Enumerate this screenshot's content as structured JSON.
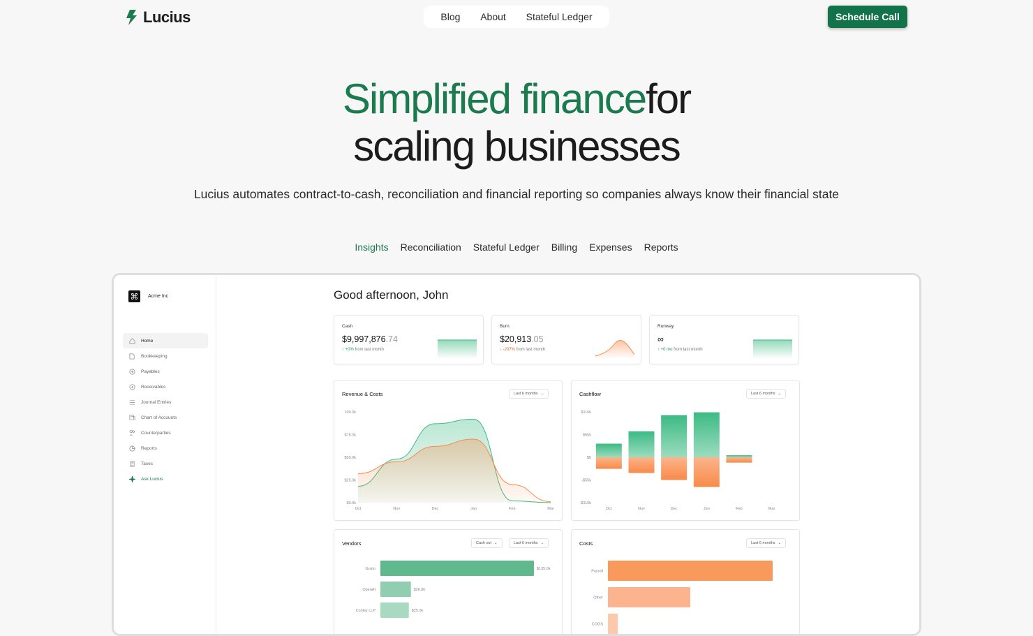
{
  "brand": {
    "name": "Lucius"
  },
  "nav": {
    "items": [
      "Blog",
      "About",
      "Stateful Ledger"
    ],
    "cta": "Schedule Call"
  },
  "hero": {
    "title_green": "Simplified finance",
    "title_dark_1": "for",
    "title_dark_2": "scaling businesses",
    "subtitle": "Lucius automates contract-to-cash, reconciliation and financial reporting so companies always know their financial state"
  },
  "tabs": [
    {
      "label": "Insights",
      "active": true
    },
    {
      "label": "Reconciliation"
    },
    {
      "label": "Stateful Ledger"
    },
    {
      "label": "Billing"
    },
    {
      "label": "Expenses"
    },
    {
      "label": "Reports"
    }
  ],
  "colors": {
    "accent": "#1b7a4e",
    "green": "#3dba84",
    "orange": "#f98a4a"
  },
  "app": {
    "org": "Acme Inc",
    "greeting": "Good afternoon, John",
    "sidebar": [
      {
        "label": "Home",
        "icon": "home-icon",
        "active": true
      },
      {
        "label": "Bookkeeping",
        "icon": "book-icon"
      },
      {
        "label": "Payables",
        "icon": "circle-plus-icon"
      },
      {
        "label": "Receivables",
        "icon": "circle-plus-icon"
      },
      {
        "label": "Journal Entries",
        "icon": "list-icon"
      },
      {
        "label": "Chart of Accounts",
        "icon": "accounts-icon"
      },
      {
        "label": "Counterparties",
        "icon": "users-icon"
      },
      {
        "label": "Reports",
        "icon": "pie-icon"
      },
      {
        "label": "Taxes",
        "icon": "receipt-icon"
      },
      {
        "label": "Ask Lucius",
        "icon": "sparkle-icon",
        "accent": true
      }
    ],
    "kpis": [
      {
        "label": "Cash",
        "value_main": "$9,997,876",
        "value_dec": ".74",
        "change": "+0%",
        "change_suffix": " from last month",
        "dir": "up"
      },
      {
        "label": "Burn",
        "value_main": "$20,913",
        "value_dec": ".05",
        "change": "-207%",
        "change_suffix": " from last month",
        "dir": "down"
      },
      {
        "label": "Runway",
        "value_main": "∞",
        "value_dec": "",
        "change": "+0 mo",
        "change_suffix": " from last month",
        "dir": "up"
      }
    ]
  },
  "chart_data": [
    {
      "type": "area",
      "title": "Revenue & Costs",
      "filter": "Last 6 months",
      "categories": [
        "Oct",
        "Nov",
        "Dec",
        "Jan",
        "Feb",
        "Mar"
      ],
      "y_ticks": [
        "100.0k",
        "$75.0k",
        "$50.0k",
        "$25.0k",
        "$0.0k"
      ],
      "ylim": [
        0,
        100000
      ],
      "series": [
        {
          "color": "#3dba84",
          "values": [
            18000,
            48000,
            87000,
            92000,
            2000,
            0
          ]
        },
        {
          "color": "#f98a4a",
          "values": [
            32000,
            45000,
            62000,
            70000,
            20000,
            1000
          ]
        }
      ]
    },
    {
      "type": "bar",
      "title": "Cashflow",
      "filter": "Last 6 months",
      "categories": [
        "Oct",
        "Nov",
        "Dec",
        "Jan",
        "Feb",
        "Mar"
      ],
      "y_ticks": [
        "$110k",
        "$55k",
        "$0",
        "-$55k",
        "-$110k"
      ],
      "ylim": [
        -110000,
        110000
      ],
      "series": [
        {
          "color": "#3dba84",
          "values": [
            33000,
            63000,
            102000,
            109000,
            5000,
            0
          ]
        },
        {
          "color": "#f98a4a",
          "values": [
            -28000,
            -38000,
            -55000,
            -72000,
            -13000,
            0
          ]
        }
      ]
    },
    {
      "type": "bar",
      "orientation": "horizontal",
      "title": "Vendors",
      "filters": [
        "Cash out",
        "Last 6 months"
      ],
      "categories": [
        "Gusto",
        "OpenAI",
        "Cooley LLP"
      ],
      "values": [
        135000,
        26800,
        25000
      ],
      "value_labels": [
        "$135.0k",
        "$26.8k",
        "$25.0k"
      ],
      "color": "#3dba84"
    },
    {
      "type": "bar",
      "orientation": "horizontal",
      "title": "Costs",
      "filter": "Last 6 months",
      "categories": [
        "Payroll",
        "Other",
        "COGS"
      ],
      "values": [
        100,
        50,
        6
      ],
      "color": "#f98a4a"
    }
  ]
}
